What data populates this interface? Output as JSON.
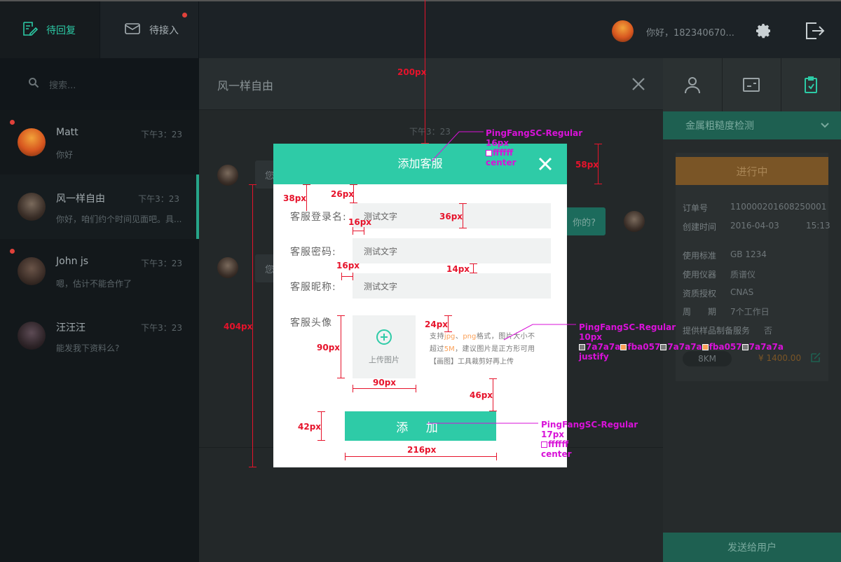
{
  "topbar": {
    "tabs": [
      {
        "label": "待回复",
        "icon": "reply-edit-icon"
      },
      {
        "label": "待接入",
        "icon": "mail-icon"
      }
    ],
    "greeting": "你好，182340670...",
    "icons": [
      "settings-icon",
      "logout-icon"
    ]
  },
  "search": {
    "placeholder": "搜索..."
  },
  "contacts": [
    {
      "name": "Matt",
      "time": "下午3：23",
      "message": "你好",
      "unread": true
    },
    {
      "name": "风一样自由",
      "time": "下午3：23",
      "message": "你好，咱们约个时间见面吧。具...",
      "unread": false,
      "active": true
    },
    {
      "name": "John js",
      "time": "下午3：23",
      "message": "嗯，估计不能合作了",
      "unread": true
    },
    {
      "name": "汪汪汪",
      "time": "下午3：23",
      "message": "能发我下资料么?",
      "unread": false
    }
  ],
  "chat": {
    "title": "风一样自由",
    "time": "下午3：23",
    "bubbles": {
      "in_1": "您",
      "out_1": "你的?",
      "in_2": "您"
    }
  },
  "right_panel": {
    "tab_icons": [
      "user-icon",
      "card-icon",
      "clipboard-icon"
    ],
    "dropdown": "金属粗糙度检测",
    "status_button": "进行中",
    "fields": [
      {
        "label": "订单号",
        "value": "110000201608250001"
      },
      {
        "label": "创建时间",
        "value": "2016-04-03",
        "extra": "15:13"
      },
      {
        "label": "使用标准",
        "value": "GB 1234"
      },
      {
        "label": "使用仪器",
        "value": "质谱仪"
      },
      {
        "label": "资质授权",
        "value": "CNAS"
      },
      {
        "label": "周　　期",
        "value": "7个工作日"
      },
      {
        "label": "提供样品制备服务",
        "value": "否"
      }
    ],
    "distance": "8KM",
    "price": "¥ 1400.00",
    "send_button": "发送给用户"
  },
  "modal": {
    "title": "添加客服",
    "fields": [
      {
        "label": "客服登录名:",
        "value": "测试文字"
      },
      {
        "label": "客服密码:",
        "value": "测试文字"
      },
      {
        "label": "客服昵称:",
        "value": "测试文字"
      }
    ],
    "avatar_label": "客服头像",
    "upload_text": "上传图片",
    "hint": {
      "p1": "支持",
      "jpg": "jpg",
      "sep": "、",
      "png": "png",
      "p2": "格式，图片大小不超过",
      "size": "5M",
      "p3": "，建议图片是正方形可用【画图】工具裁剪好再上传"
    },
    "submit": "添 加"
  },
  "annotations": {
    "dims": [
      "200px",
      "38px",
      "26px",
      "16px",
      "36px",
      "16px",
      "14px",
      "24px",
      "90px",
      "90px",
      "46px",
      "42px",
      "216px",
      "404px",
      "58px"
    ],
    "title_spec": [
      "PingFangSC-Regular",
      "16px",
      "ffffff",
      "center"
    ],
    "hint_spec": [
      "PingFangSC-Regular",
      "10px",
      "7a7a7a",
      "fba057",
      "7a7a7a",
      "fba057",
      "7a7a7a",
      "justify"
    ],
    "button_spec": [
      "PingFangSC-Regular",
      "17px",
      "ffffff",
      "center"
    ]
  },
  "colors": {
    "accent": "#2ecba7",
    "highlight": "#fba057",
    "hint": "#7a7a7a",
    "annotation": "#e6132b",
    "spec": "#d812d8"
  }
}
